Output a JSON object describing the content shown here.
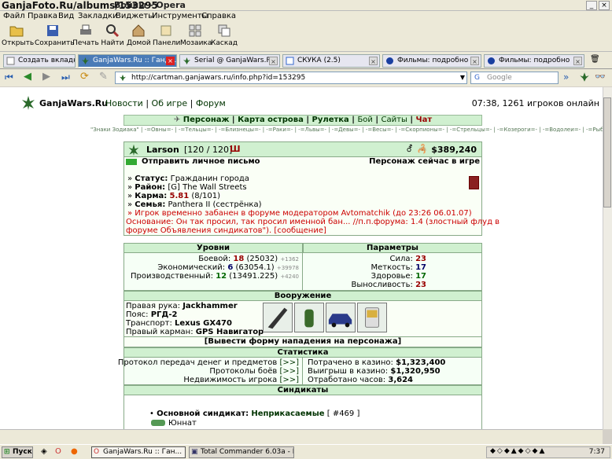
{
  "window": {
    "watermark": "GanjaFoto.Ru/albums/153295",
    "title_tail": "Войны - Opera"
  },
  "menu": [
    "Файл",
    "Правка",
    "Вид",
    "Закладки",
    "Виджеты",
    "Инструменты",
    "Справка"
  ],
  "toolbar": [
    "Открыть",
    "Сохранить",
    "Печать",
    "Найти",
    "Домой",
    "Панели",
    "Мозаика",
    "Каскад"
  ],
  "tabs": {
    "new_tab": "Создать вкладку",
    "items": [
      "GanjaWars.Ru :: Ганд...",
      "Serial @ GanjaWars.Ru",
      "СКУКА (2.5)",
      "Фильмы: подробно",
      "Фильмы: подробно"
    ]
  },
  "address": {
    "url": "http://cartman.ganjawars.ru/info.php?id=153295",
    "search_placeholder": "Google"
  },
  "site": {
    "name": "GanjaWars.Ru",
    "links": [
      "Новости",
      "Об игре",
      "Форум"
    ],
    "online": "07:38, 1261 игроков онлайн",
    "main_menu": [
      "Персонаж",
      "Карта острова",
      "Рулетка",
      "Бой",
      "Сайты",
      "Чат"
    ],
    "zodiac": "\"Знаки Зодиака\" | -=Овны=- | -=Тельцы=- | -=Близнецы=- | -=Раки=- | -=Львы=- | -=Девы=- | -=Весы=- | -=Скорпионы=- | -=Стрельцы=- | -=Козероги=- | -=Водолеи=- | -=Рыбы=- | статистика"
  },
  "player": {
    "name": "Larson",
    "hp": "[120 / 120]",
    "money": "$389,240",
    "send_mail": "Отправить личное письмо",
    "online_status": "Персонаж сейчас в игре",
    "status_label": "Статус:",
    "status": "Гражданин города",
    "district_label": "Район:",
    "district": "[G] The Wall Streets",
    "karma_label": "Карма:",
    "karma_value": "5.81",
    "karma_ratio": "(8/101)",
    "family_label": "Семья:",
    "family": "Panthera II (сестрёнка)",
    "ban_line": "» Игрок временно забанен в форуме модератором Avtomatchik (до 23:26 06.01.07)",
    "reason_line1": "Основание: Он так просил, так просил именной бан... //п.п.форума: 1.4 (злостный флуд в",
    "reason_line2": "форуме Объявления синдикатов\"). ",
    "reason_link": "[сообщение]"
  },
  "levels": {
    "header": "Уровни",
    "rows": [
      {
        "label": "Боевой:",
        "value": "18",
        "detail": "(25032)",
        "delta": "+1362"
      },
      {
        "label": "Экономический:",
        "value": "6",
        "detail": "(63054.1)",
        "delta": "+39978"
      },
      {
        "label": "Производственный:",
        "value": "12",
        "detail": "(13491.225)",
        "delta": "+4240"
      }
    ]
  },
  "params": {
    "header": "Параметры",
    "rows": [
      {
        "label": "Сила:",
        "value": "23"
      },
      {
        "label": "Меткость:",
        "value": "17"
      },
      {
        "label": "Здоровье:",
        "value": "17"
      },
      {
        "label": "Выносливость:",
        "value": "23"
      }
    ]
  },
  "armament": {
    "header": "Вооружение",
    "rows": [
      {
        "label": "Правая рука:",
        "value": "Jackhammer"
      },
      {
        "label": "Пояс:",
        "value": "РГД-2"
      },
      {
        "label": "Транспорт:",
        "value": "Lexus GX470"
      },
      {
        "label": "Правый карман:",
        "value": "GPS Навигатор"
      }
    ],
    "attack_link": "[Вывести форму нападения на персонажа]"
  },
  "statistics": {
    "header": "Статистика",
    "left": [
      "Протокол передач денег и предметов",
      "Протоколы боёв",
      "Недвижимость игрока"
    ],
    "button": "[>>]",
    "right": [
      {
        "label": "Потрачено в казино:",
        "value": "$1,323,400"
      },
      {
        "label": "Выигрыш в казино:",
        "value": "$1,320,950"
      },
      {
        "label": "Отработано часов:",
        "value": "3,624"
      }
    ]
  },
  "syndicates": {
    "header": "Синдикаты",
    "main_label": "Основной синдикат:",
    "main_name": "Неприкасаемые",
    "main_id": "[ #469 ]",
    "rank": "Юннат"
  },
  "taskbar": {
    "start": "Пуск",
    "items": [
      "GanjaWars.Ru :: Ган...",
      "Total Commander 6.03a - I..."
    ],
    "clock": "7:37"
  }
}
